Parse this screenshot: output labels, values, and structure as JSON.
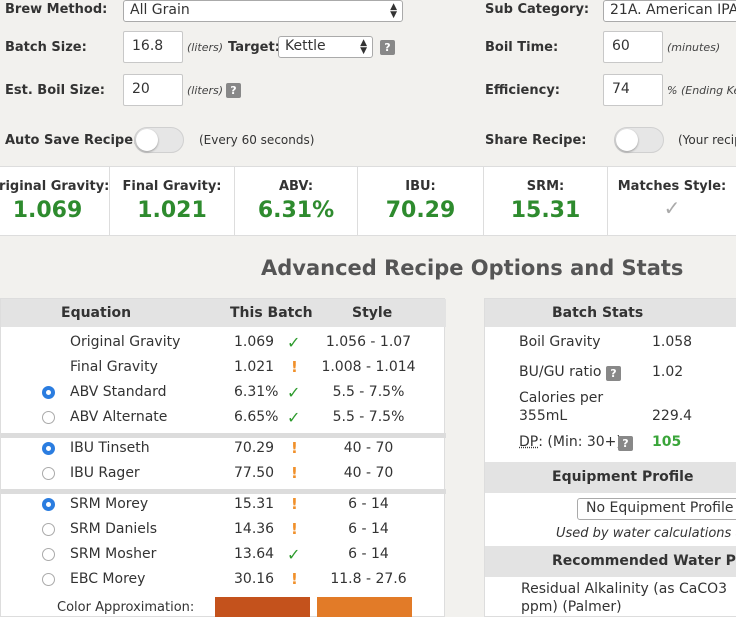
{
  "form": {
    "brew_method_label": "Brew Method:",
    "brew_method_value": "All Grain",
    "sub_category_label": "Sub Category:",
    "sub_category_value": "21A. American IPA",
    "batch_size_label": "Batch Size:",
    "batch_size_value": "16.8",
    "batch_size_unit": "(liters)",
    "target_label": "Target:",
    "target_value": "Kettle",
    "boil_time_label": "Boil Time:",
    "boil_time_value": "60",
    "boil_time_unit": "(minutes)",
    "est_boil_label": "Est. Boil Size:",
    "est_boil_value": "20",
    "est_boil_unit": "(liters)",
    "efficiency_label": "Efficiency:",
    "efficiency_value": "74",
    "efficiency_unit": "% (Ending Ket",
    "auto_save_label": "Auto Save Recipe:",
    "auto_save_note": "(Every 60 seconds)",
    "share_label": "Share Recipe:",
    "share_note": "(Your recip",
    "help": "?"
  },
  "stats": [
    {
      "title": "Original Gravity:",
      "value": "1.069"
    },
    {
      "title": "Final Gravity:",
      "value": "1.021"
    },
    {
      "title": "ABV:",
      "value": "6.31%"
    },
    {
      "title": "IBU:",
      "value": "70.29"
    },
    {
      "title": "SRM:",
      "value": "15.31"
    },
    {
      "title": "Matches Style:",
      "value": ""
    }
  ],
  "advanced": {
    "heading": "Advanced Recipe Options and Stats",
    "col_equation": "Equation",
    "col_batch": "This Batch",
    "col_style": "Style",
    "rows": [
      {
        "name": "Original Gravity",
        "batch": "1.069",
        "status": "check",
        "style": "1.056 - 1.07"
      },
      {
        "name": "Final Gravity",
        "batch": "1.021",
        "status": "warn",
        "style": "1.008 - 1.014"
      },
      {
        "name": "ABV Standard",
        "batch": "6.31%",
        "status": "check",
        "style": "5.5 - 7.5%"
      },
      {
        "name": "ABV Alternate",
        "batch": "6.65%",
        "status": "check",
        "style": "5.5 - 7.5%"
      },
      {
        "name": "IBU Tinseth",
        "batch": "70.29",
        "status": "warn",
        "style": "40 - 70"
      },
      {
        "name": "IBU Rager",
        "batch": "77.50",
        "status": "warn",
        "style": "40 - 70"
      },
      {
        "name": "SRM Morey",
        "batch": "15.31",
        "status": "warn",
        "style": "6 - 14"
      },
      {
        "name": "SRM Daniels",
        "batch": "14.36",
        "status": "warn",
        "style": "6 - 14"
      },
      {
        "name": "SRM Mosher",
        "batch": "13.64",
        "status": "check",
        "style": "6 - 14"
      },
      {
        "name": "EBC Morey",
        "batch": "30.16",
        "status": "warn",
        "style": "11.8 - 27.6"
      }
    ],
    "color_label": "Color Approximation:",
    "color_batch": "#c4521c",
    "color_style": "#e27b28"
  },
  "batch_stats": {
    "header": "Batch Stats",
    "boil_gravity_label": "Boil Gravity",
    "boil_gravity_value": "1.058",
    "bugu_label": "BU/GU ratio",
    "bugu_value": "1.02",
    "calories_label_1": "Calories per",
    "calories_label_2": "355mL",
    "calories_value": "229.4",
    "dp_abbr": "DP",
    "dp_label": ": (Min: 30+)",
    "dp_value": "105",
    "equipment_header": "Equipment Profile",
    "equipment_value": "No Equipment Profile S",
    "equipment_note": "Used by water calculations ar",
    "water_header": "Recommended Water Profil",
    "residual_1": "Residual Alkalinity (as CaCO3",
    "residual_2": "ppm) (Palmer)"
  },
  "colors": {
    "accent_green": "#2e8b2e",
    "warning_orange": "#f0902a"
  }
}
